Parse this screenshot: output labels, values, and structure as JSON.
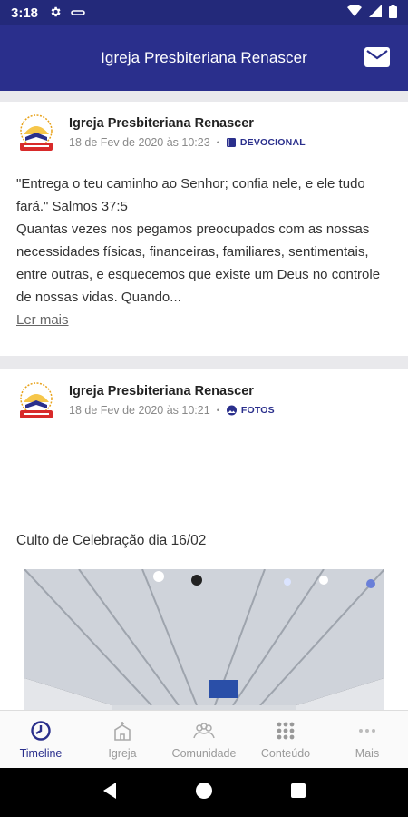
{
  "status_bar": {
    "time": "3:18"
  },
  "app_bar": {
    "title": "Igreja Presbiteriana Renascer"
  },
  "posts": [
    {
      "author": "Igreja Presbiteriana Renascer",
      "date": "18 de Fev de 2020 às 10:23",
      "category": "DEVOCIONAL",
      "text": "\"Entrega o teu caminho ao Senhor; confia nele, e ele tudo fará.\" Salmos 37:5\nQuantas vezes nos pegamos preocupados com as nossas necessidades físicas, financeiras, familiares, sentimentais, entre outras, e esquecemos que existe um Deus no controle de nossas vidas. Quando...",
      "read_more": "Ler mais"
    },
    {
      "author": "Igreja Presbiteriana Renascer",
      "date": "18 de Fev de 2020 às 10:21",
      "category": "FOTOS",
      "caption": "Culto de Celebração dia 16/02"
    }
  ],
  "bottom_nav": [
    {
      "label": "Timeline",
      "icon": "timeline-icon",
      "active": true
    },
    {
      "label": "Igreja",
      "icon": "church-icon",
      "active": false
    },
    {
      "label": "Comunidade",
      "icon": "community-icon",
      "active": false
    },
    {
      "label": "Conteúdo",
      "icon": "content-grid-icon",
      "active": false
    },
    {
      "label": "Mais",
      "icon": "more-icon",
      "active": false
    }
  ],
  "colors": {
    "primary": "#2a2f8c",
    "status_bar": "#23297a",
    "accent_red": "#d82a2a",
    "accent_gold": "#e8a21a"
  }
}
